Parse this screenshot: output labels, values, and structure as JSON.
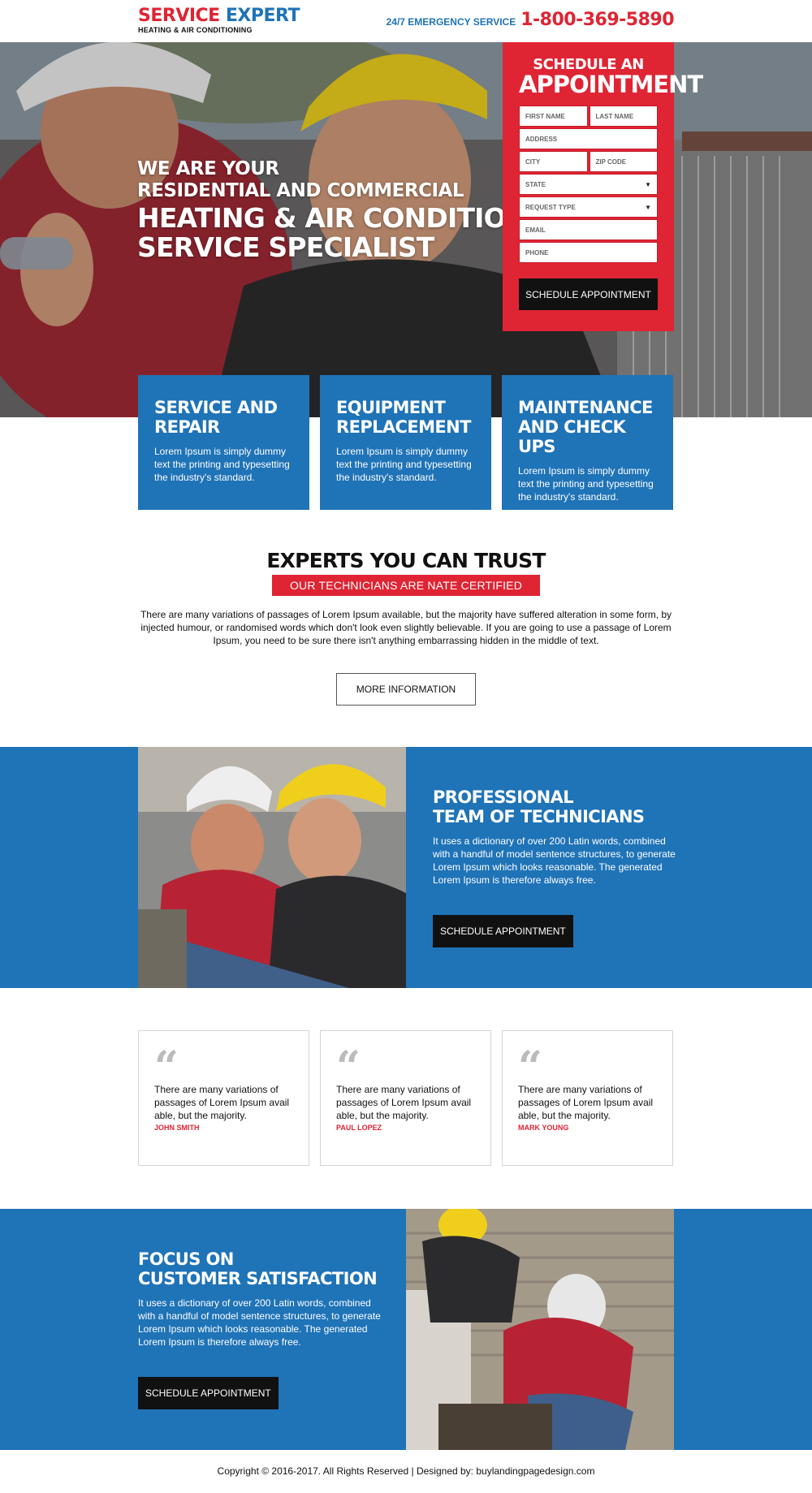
{
  "header": {
    "logo_part1": "SERVICE",
    "logo_part2": "EXPERT",
    "logo_sub": "HEATING & AIR CONDITIONING",
    "emergency_label": "24/7 EMERGENCY SERVICE",
    "phone": "1-800-369-5890"
  },
  "hero": {
    "line1": "WE ARE YOUR",
    "line2": "RESIDENTIAL AND COMMERCIAL",
    "line3": "HEATING & AIR CONDITIONING",
    "line4": "SERVICE SPECIALIST"
  },
  "form": {
    "title1": "SCHEDULE AN",
    "title2": "APPOINTMENT",
    "first_name": "FIRST NAME",
    "last_name": "LAST NAME",
    "address": "ADDRESS",
    "city": "CITY",
    "zip": "ZIP CODE",
    "state": "STATE",
    "request_type": "REQUEST TYPE",
    "email": "EMAIL",
    "phone": "PHONE",
    "submit": "SCHEDULE APPOINTMENT",
    "arrow": "▼"
  },
  "features": [
    {
      "title1": "SERVICE AND",
      "title2": "REPAIR",
      "body": "Lorem Ipsum is simply dummy text the printing and typesetting the industry's standard."
    },
    {
      "title1": "EQUIPMENT",
      "title2": "REPLACEMENT",
      "body": "Lorem Ipsum is simply dummy text the printing and typesetting the industry's standard."
    },
    {
      "title1": "MAINTENANCE",
      "title2": "AND CHECK UPS",
      "body": "Lorem Ipsum is simply dummy text the printing and typesetting the industry's standard."
    }
  ],
  "experts": {
    "title": "EXPERTS YOU CAN TRUST",
    "badge": "OUR TECHNICIANS ARE NATE CERTIFIED",
    "body": "There are many variations of passages of Lorem Ipsum available, but the majority have suffered alteration in some form, by injected humour, or randomised words which don't look even slightly believable. If you are going to use a passage of Lorem Ipsum, you need to be sure there isn't anything embarrassing hidden in the middle of text.",
    "button": "MORE INFORMATION"
  },
  "pro": {
    "title1": "PROFESSIONAL",
    "title2": "TEAM OF TECHNICIANS",
    "body": "It uses a dictionary of over 200 Latin words, combined with a handful of model sentence structures, to generate Lorem Ipsum which looks reasonable. The generated Lorem Ipsum is therefore always free.",
    "button": "SCHEDULE APPOINTMENT"
  },
  "testimonials": [
    {
      "quote_mark": "“",
      "body": "There are many variations of passages of Lorem Ipsum avail able, but the majority.",
      "name": "JOHN SMITH"
    },
    {
      "quote_mark": "“",
      "body": "There are many variations of passages of Lorem Ipsum avail able, but the majority.",
      "name": "PAUL LOPEZ"
    },
    {
      "quote_mark": "“",
      "body": "There are many variations of passages of Lorem Ipsum avail able, but the majority.",
      "name": "MARK YOUNG"
    }
  ],
  "focus": {
    "title1": "FOCUS ON",
    "title2": "CUSTOMER SATISFACTION",
    "body": "It uses a dictionary of over 200 Latin words, combined with a handful of model sentence structures, to generate Lorem Ipsum which looks reasonable. The generated Lorem Ipsum is therefore always free.",
    "button": "SCHEDULE APPOINTMENT"
  },
  "footer": {
    "text": "Copyright © 2016-2017. All Rights Reserved  |  Designed by: buylandingpagedesign.com"
  },
  "colors": {
    "brand_red": "#df2433",
    "brand_blue": "#1f73b7",
    "dark": "#111111"
  }
}
